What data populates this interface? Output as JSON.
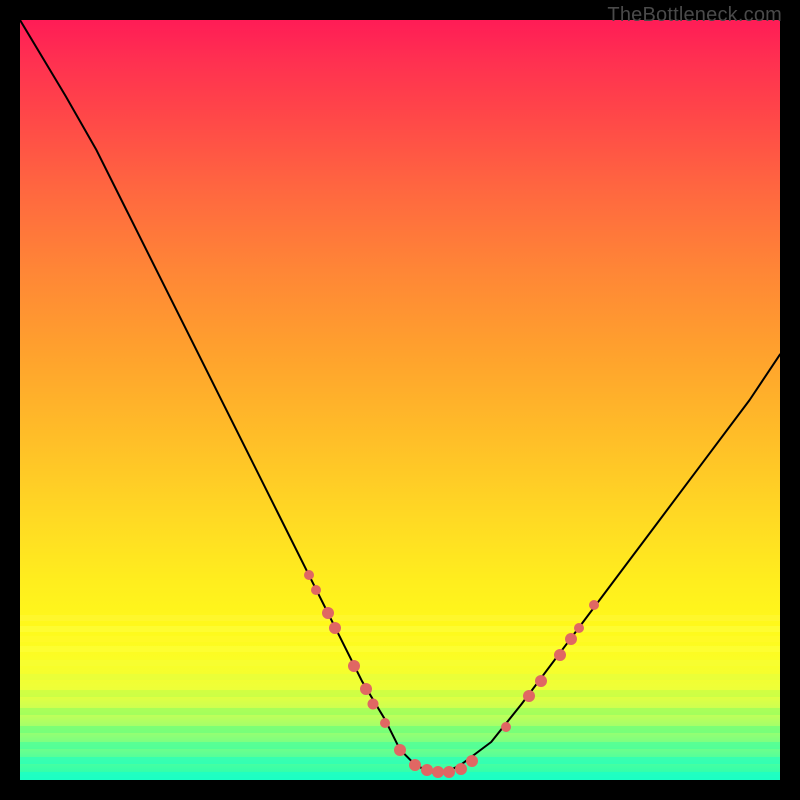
{
  "watermark": {
    "text": "TheBottleneck.com"
  },
  "chart_data": {
    "type": "line",
    "title": "",
    "xlabel": "",
    "ylabel": "",
    "xlim": [
      0,
      100
    ],
    "ylim": [
      0,
      100
    ],
    "series": [
      {
        "name": "bottleneck-curve",
        "x": [
          0,
          3,
          6,
          10,
          14,
          18,
          22,
          26,
          30,
          34,
          38,
          42,
          45,
          48,
          50,
          52,
          54,
          56,
          58,
          62,
          66,
          72,
          78,
          84,
          90,
          96,
          100
        ],
        "y": [
          100,
          95,
          90,
          83,
          75,
          67,
          59,
          51,
          43,
          35,
          27,
          19,
          13,
          8,
          4,
          2,
          1,
          1,
          2,
          5,
          10,
          18,
          26,
          34,
          42,
          50,
          56
        ]
      }
    ],
    "markers": {
      "name": "highlighted-points",
      "color": "#e06763",
      "points": [
        {
          "x": 38,
          "y": 27,
          "size": 10
        },
        {
          "x": 39,
          "y": 25,
          "size": 10
        },
        {
          "x": 40.5,
          "y": 22,
          "size": 12
        },
        {
          "x": 41.5,
          "y": 20,
          "size": 12
        },
        {
          "x": 44,
          "y": 15,
          "size": 12
        },
        {
          "x": 45.5,
          "y": 12,
          "size": 12
        },
        {
          "x": 46.5,
          "y": 10,
          "size": 11
        },
        {
          "x": 48,
          "y": 7.5,
          "size": 10
        },
        {
          "x": 50,
          "y": 4,
          "size": 12
        },
        {
          "x": 52,
          "y": 2,
          "size": 12
        },
        {
          "x": 53.5,
          "y": 1.3,
          "size": 12
        },
        {
          "x": 55,
          "y": 1,
          "size": 12
        },
        {
          "x": 56.5,
          "y": 1,
          "size": 12
        },
        {
          "x": 58,
          "y": 1.5,
          "size": 12
        },
        {
          "x": 59.5,
          "y": 2.5,
          "size": 12
        },
        {
          "x": 64,
          "y": 7,
          "size": 10
        },
        {
          "x": 67,
          "y": 11,
          "size": 12
        },
        {
          "x": 68.5,
          "y": 13,
          "size": 12
        },
        {
          "x": 71,
          "y": 16.5,
          "size": 12
        },
        {
          "x": 72.5,
          "y": 18.5,
          "size": 12
        },
        {
          "x": 73.5,
          "y": 20,
          "size": 10
        },
        {
          "x": 75.5,
          "y": 23,
          "size": 10
        }
      ]
    },
    "gradient_stops": [
      {
        "pos": 0,
        "color": "#ff1c56"
      },
      {
        "pos": 20,
        "color": "#ff5b44"
      },
      {
        "pos": 40,
        "color": "#ff9530"
      },
      {
        "pos": 60,
        "color": "#ffcc26"
      },
      {
        "pos": 80,
        "color": "#fff91b"
      },
      {
        "pos": 100,
        "color": "#20ffb5"
      }
    ],
    "horizontal_bands": [
      {
        "ypx": 595,
        "h": 6,
        "color": "rgba(255,247,59,0.55)"
      },
      {
        "ypx": 606,
        "h": 6,
        "color": "rgba(254,255,68,0.55)"
      },
      {
        "ypx": 616,
        "h": 6,
        "color": "rgba(255,250,40,0.75)"
      },
      {
        "ypx": 626,
        "h": 6,
        "color": "rgba(254,255,62,0.55)"
      },
      {
        "ypx": 640,
        "h": 6,
        "color": "rgba(246,255,55,0.55)"
      },
      {
        "ypx": 654,
        "h": 6,
        "color": "rgba(225,255,64,0.55)"
      },
      {
        "ypx": 670,
        "h": 7,
        "color": "rgba(188,255,72,0.55)"
      },
      {
        "ypx": 688,
        "h": 7,
        "color": "rgba(140,255,94,0.55)"
      },
      {
        "ypx": 706,
        "h": 7,
        "color": "rgba(100,255,126,0.6)"
      },
      {
        "ypx": 722,
        "h": 7,
        "color": "rgba(66,255,160,0.6)"
      },
      {
        "ypx": 737,
        "h": 7,
        "color": "rgba(42,255,188,0.65)"
      },
      {
        "ypx": 752,
        "h": 8,
        "color": "rgba(26,255,202,0.7)"
      }
    ]
  }
}
